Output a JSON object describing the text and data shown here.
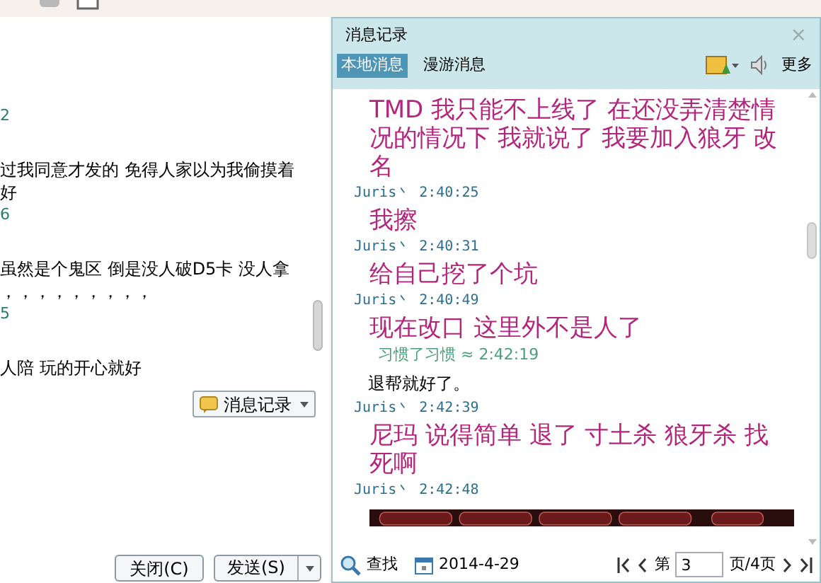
{
  "chat": {
    "lines": [
      {
        "kind": "time",
        "text": "2"
      },
      {
        "kind": "text",
        "text": "过我同意才发的 免得人家以为我偷摸着"
      },
      {
        "kind": "text",
        "text": "好"
      },
      {
        "kind": "time",
        "text": "6"
      },
      {
        "kind": "text",
        "text": "虽然是个鬼区 倒是没人破D5卡 没人拿"
      },
      {
        "kind": "text",
        "text": "，，，，，，，，，"
      },
      {
        "kind": "time",
        "text": "5"
      },
      {
        "kind": "text",
        "text": "人陪 玩的开心就好"
      }
    ],
    "history_button": "消息记录",
    "buttons": [
      "关闭(C)",
      "发送(S)"
    ]
  },
  "history": {
    "title": "消息记录",
    "close": "×",
    "tabs": [
      {
        "label": "本地消息",
        "selected": true
      },
      {
        "label": "漫游消息",
        "selected": false
      }
    ],
    "more": "更多",
    "messages": [
      {
        "kind": "message",
        "text": "TMD 我只能不上线了 在还没弄清楚情况的情况下 我就说了 我要加入狼牙 改名"
      },
      {
        "kind": "sender",
        "text": "Juris丶 2:40:25"
      },
      {
        "kind": "message",
        "text": "我擦"
      },
      {
        "kind": "sender",
        "text": "Juris丶 2:40:31"
      },
      {
        "kind": "message",
        "text": "给自己挖了个坑"
      },
      {
        "kind": "sender",
        "text": "Juris丶 2:40:49"
      },
      {
        "kind": "message",
        "text": "现在改口 这里外不是人了"
      },
      {
        "kind": "quote",
        "text": "习惯了习惯 ≈ 2:42:19"
      },
      {
        "kind": "plain",
        "text": "退帮就好了。"
      },
      {
        "kind": "sender",
        "text": "Juris丶 2:42:39"
      },
      {
        "kind": "message",
        "text": "尼玛 说得简单 退了 寸土杀 狼牙杀 找死啊"
      },
      {
        "kind": "sender",
        "text": "Juris丶 2:42:48"
      }
    ],
    "footer": {
      "search": "查找",
      "date": "2014-4-29",
      "page_prefix": "第",
      "page": "3",
      "page_suffix": "页/4页"
    }
  }
}
